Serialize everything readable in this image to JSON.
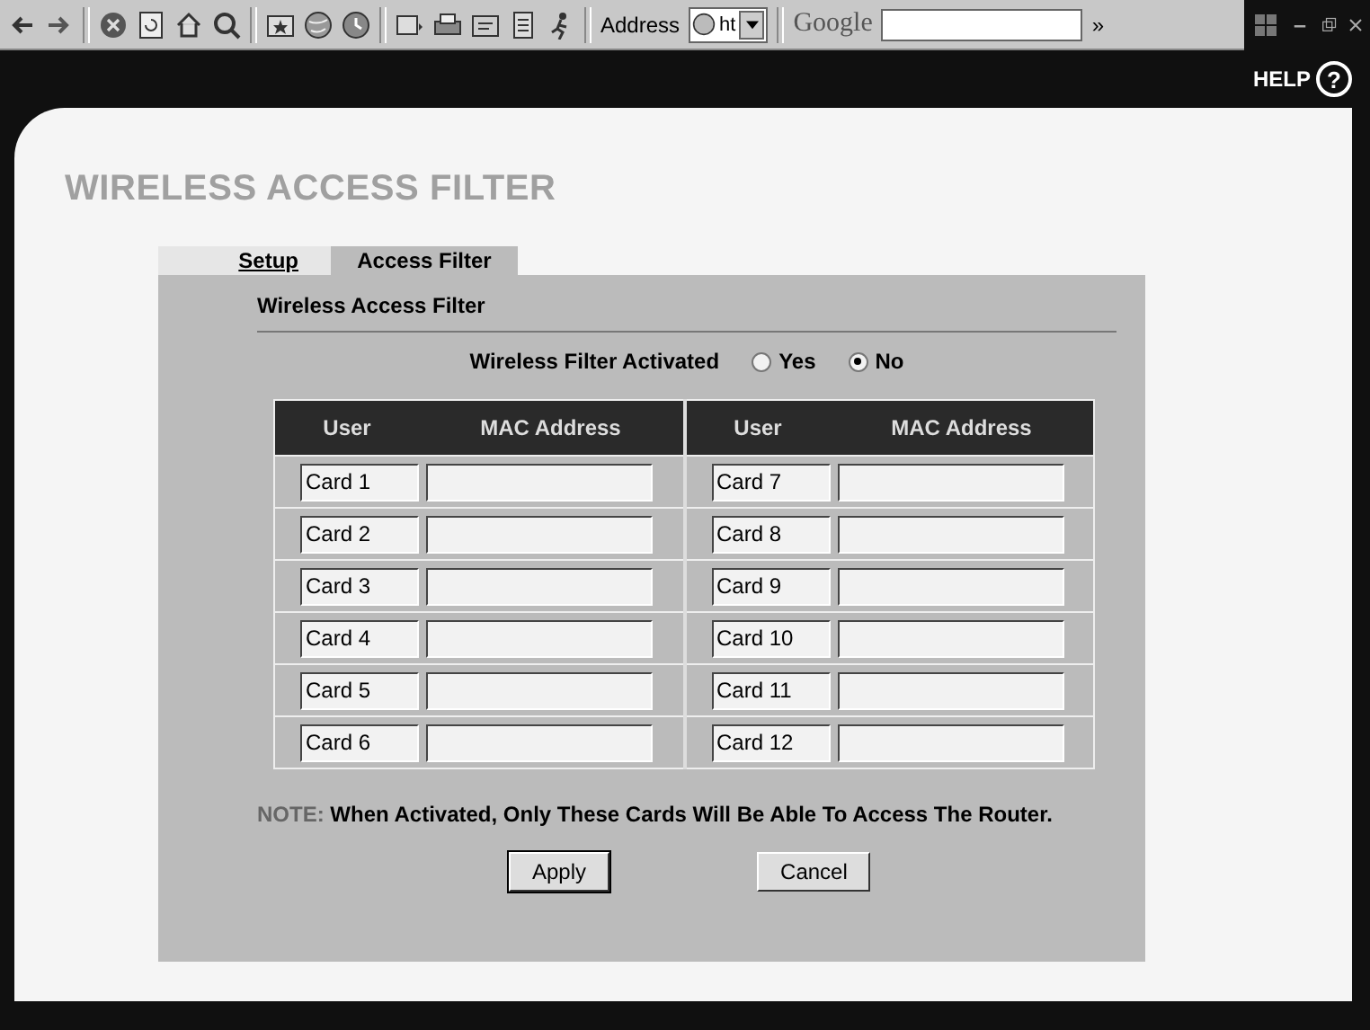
{
  "toolbar": {
    "address_label": "Address",
    "address_value": "ht",
    "search_label": "Google",
    "overflow": "»"
  },
  "header": {
    "help_label": "HELP",
    "help_symbol": "?"
  },
  "page_title": "WIRELESS ACCESS FILTER",
  "tabs": [
    {
      "label": "Setup",
      "selected": false
    },
    {
      "label": "Access Filter",
      "selected": true
    }
  ],
  "section_title": "Wireless Access Filter",
  "filter": {
    "label": "Wireless Filter Activated",
    "options": [
      {
        "label": "Yes",
        "selected": false
      },
      {
        "label": "No",
        "selected": true
      }
    ]
  },
  "table": {
    "columns": [
      "User",
      "MAC Address",
      "User",
      "MAC Address"
    ],
    "rows": [
      {
        "left": {
          "user": "Card 1"
        },
        "right": {
          "user": "Card 7"
        }
      },
      {
        "left": {
          "user": "Card 2"
        },
        "right": {
          "user": "Card 8"
        }
      },
      {
        "left": {
          "user": "Card 3"
        },
        "right": {
          "user": "Card 9"
        }
      },
      {
        "left": {
          "user": "Card 4"
        },
        "right": {
          "user": "Card 10"
        }
      },
      {
        "left": {
          "user": "Card 5"
        },
        "right": {
          "user": "Card 11"
        }
      },
      {
        "left": {
          "user": "Card 6"
        },
        "right": {
          "user": "Card 12"
        }
      }
    ]
  },
  "note": {
    "label": "NOTE:",
    "text": "When Activated, Only These Cards Will Be Able To Access The Router."
  },
  "buttons": [
    {
      "label": "Apply",
      "default": true
    },
    {
      "label": "Cancel",
      "default": false
    }
  ]
}
